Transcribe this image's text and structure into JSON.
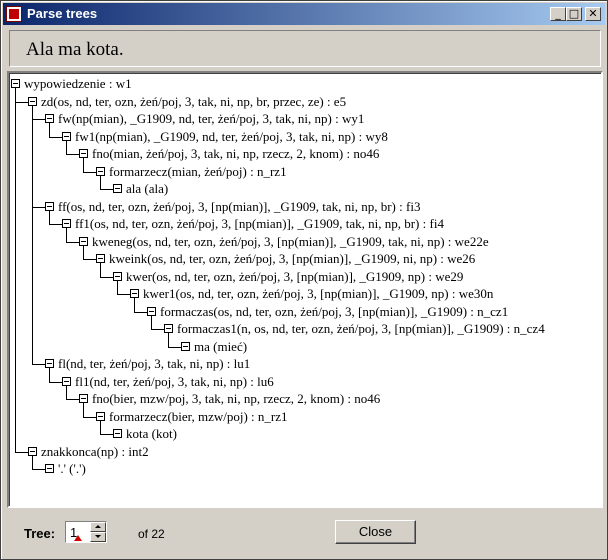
{
  "window": {
    "title": "Parse trees",
    "minimize_glyph": "_",
    "maximize_glyph": "□",
    "close_glyph": "✕"
  },
  "sentence": "Ala ma kota.",
  "tree": [
    {
      "label": "wypowiedzenie : w1",
      "depth": 0
    },
    {
      "label": "zd(os, nd, ter, ozn, żeń/poj, 3, tak, ni, np, br, przec, ze) : e5",
      "depth": 1
    },
    {
      "label": "fw(np(mian), _G1909, nd, ter, żeń/poj, 3, tak, ni, np) : wy1",
      "depth": 2
    },
    {
      "label": "fw1(np(mian), _G1909, nd, ter, żeń/poj, 3, tak, ni, np) : wy8",
      "depth": 3
    },
    {
      "label": "fno(mian, żeń/poj, 3, tak, ni, np, rzecz, 2, knom) : no46",
      "depth": 4
    },
    {
      "label": "formarzecz(mian, żeń/poj) : n_rz1",
      "depth": 5
    },
    {
      "label": "ala (ala)",
      "depth": 6
    },
    {
      "label": "ff(os, nd, ter, ozn, żeń/poj, 3, [np(mian)], _G1909, tak, ni, np, br) : fi3",
      "depth": 2
    },
    {
      "label": "ff1(os, nd, ter, ozn, żeń/poj, 3, [np(mian)], _G1909, tak, ni, np, br) : fi4",
      "depth": 3
    },
    {
      "label": "kweneg(os, nd, ter, ozn, żeń/poj, 3, [np(mian)], _G1909, tak, ni, np) : we22e",
      "depth": 4
    },
    {
      "label": "kweink(os, nd, ter, ozn, żeń/poj, 3, [np(mian)], _G1909, ni, np) : we26",
      "depth": 5
    },
    {
      "label": "kwer(os, nd, ter, ozn, żeń/poj, 3, [np(mian)], _G1909, np) : we29",
      "depth": 6
    },
    {
      "label": "kwer1(os, nd, ter, ozn, żeń/poj, 3, [np(mian)], _G1909, np) : we30n",
      "depth": 7
    },
    {
      "label": "formaczas(os, nd, ter, ozn, żeń/poj, 3, [np(mian)], _G1909) : n_cz1",
      "depth": 8
    },
    {
      "label": "formaczas1(n, os, nd, ter, ozn, żeń/poj, 3, [np(mian)], _G1909) : n_cz4",
      "depth": 9
    },
    {
      "label": "ma (mieć)",
      "depth": 10
    },
    {
      "label": "fl(nd, ter, żeń/poj, 3, tak, ni, np) : lu1",
      "depth": 2
    },
    {
      "label": "fl1(nd, ter, żeń/poj, 3, tak, ni, np) : lu6",
      "depth": 3
    },
    {
      "label": "fno(bier, mzw/poj, 3, tak, ni, np, rzecz, 2, knom) : no46",
      "depth": 4
    },
    {
      "label": "formarzecz(bier, mzw/poj) : n_rz1",
      "depth": 5
    },
    {
      "label": "kota (kot)",
      "depth": 6
    },
    {
      "label": "znakkonca(np) : int2",
      "depth": 1
    },
    {
      "label": "'.' ('.')",
      "depth": 2
    }
  ],
  "footer": {
    "tree_label": "Tree:",
    "tree_value": "1",
    "of_label": "of 22",
    "close_label": "Close"
  }
}
